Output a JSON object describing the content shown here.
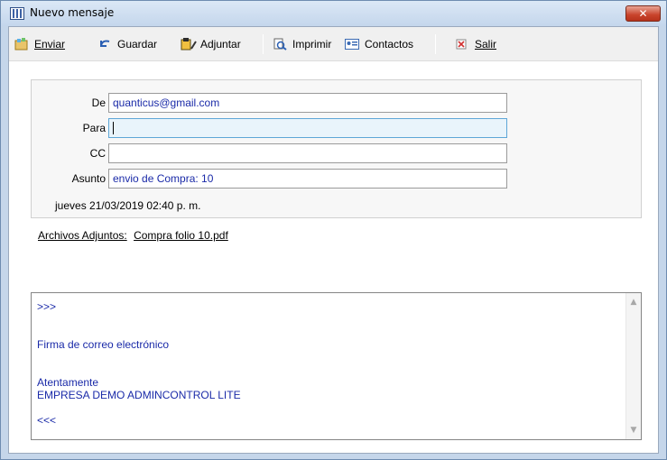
{
  "window": {
    "title": "Nuevo mensaje",
    "close_glyph": "✕"
  },
  "toolbar": {
    "enviar": "Enviar",
    "guardar": "Guardar",
    "adjuntar": "Adjuntar",
    "imprimir": "Imprimir",
    "contactos": "Contactos",
    "salir": "Salir"
  },
  "fields": {
    "de_label": "De",
    "de_value": "quanticus@gmail.com",
    "para_label": "Para",
    "para_value": "",
    "cc_label": "CC",
    "cc_value": "",
    "asunto_label": "Asunto",
    "asunto_value": "envio de Compra: 10"
  },
  "date": "jueves 21/03/2019 02:40 p. m.",
  "attachments": {
    "label": "Archivos Adjuntos:",
    "file": "Compra folio 10.pdf"
  },
  "body": {
    "lines": [
      ">>>",
      "",
      "",
      "Firma de correo electrónico",
      "",
      "",
      "Atentamente",
      "EMPRESA DEMO ADMINCONTROL LITE",
      "",
      "<<<"
    ]
  },
  "colors": {
    "accent_text": "#1a2aa8",
    "close_button": "#c8432b",
    "titlebar": "#c4d6ec"
  },
  "icons": [
    "window-icon",
    "send-icon",
    "save-icon",
    "attach-icon",
    "print-icon",
    "contacts-icon",
    "exit-icon"
  ]
}
